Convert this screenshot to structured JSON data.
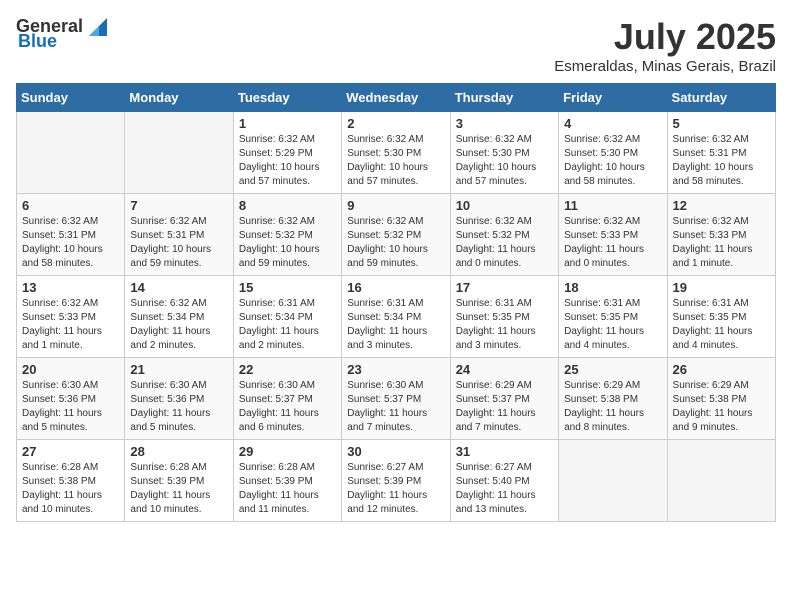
{
  "header": {
    "logo_general": "General",
    "logo_blue": "Blue",
    "month_year": "July 2025",
    "location": "Esmeraldas, Minas Gerais, Brazil"
  },
  "days_of_week": [
    "Sunday",
    "Monday",
    "Tuesday",
    "Wednesday",
    "Thursday",
    "Friday",
    "Saturday"
  ],
  "weeks": [
    [
      {
        "day": "",
        "info": ""
      },
      {
        "day": "",
        "info": ""
      },
      {
        "day": "1",
        "info": "Sunrise: 6:32 AM\nSunset: 5:29 PM\nDaylight: 10 hours and 57 minutes."
      },
      {
        "day": "2",
        "info": "Sunrise: 6:32 AM\nSunset: 5:30 PM\nDaylight: 10 hours and 57 minutes."
      },
      {
        "day": "3",
        "info": "Sunrise: 6:32 AM\nSunset: 5:30 PM\nDaylight: 10 hours and 57 minutes."
      },
      {
        "day": "4",
        "info": "Sunrise: 6:32 AM\nSunset: 5:30 PM\nDaylight: 10 hours and 58 minutes."
      },
      {
        "day": "5",
        "info": "Sunrise: 6:32 AM\nSunset: 5:31 PM\nDaylight: 10 hours and 58 minutes."
      }
    ],
    [
      {
        "day": "6",
        "info": "Sunrise: 6:32 AM\nSunset: 5:31 PM\nDaylight: 10 hours and 58 minutes."
      },
      {
        "day": "7",
        "info": "Sunrise: 6:32 AM\nSunset: 5:31 PM\nDaylight: 10 hours and 59 minutes."
      },
      {
        "day": "8",
        "info": "Sunrise: 6:32 AM\nSunset: 5:32 PM\nDaylight: 10 hours and 59 minutes."
      },
      {
        "day": "9",
        "info": "Sunrise: 6:32 AM\nSunset: 5:32 PM\nDaylight: 10 hours and 59 minutes."
      },
      {
        "day": "10",
        "info": "Sunrise: 6:32 AM\nSunset: 5:32 PM\nDaylight: 11 hours and 0 minutes."
      },
      {
        "day": "11",
        "info": "Sunrise: 6:32 AM\nSunset: 5:33 PM\nDaylight: 11 hours and 0 minutes."
      },
      {
        "day": "12",
        "info": "Sunrise: 6:32 AM\nSunset: 5:33 PM\nDaylight: 11 hours and 1 minute."
      }
    ],
    [
      {
        "day": "13",
        "info": "Sunrise: 6:32 AM\nSunset: 5:33 PM\nDaylight: 11 hours and 1 minute."
      },
      {
        "day": "14",
        "info": "Sunrise: 6:32 AM\nSunset: 5:34 PM\nDaylight: 11 hours and 2 minutes."
      },
      {
        "day": "15",
        "info": "Sunrise: 6:31 AM\nSunset: 5:34 PM\nDaylight: 11 hours and 2 minutes."
      },
      {
        "day": "16",
        "info": "Sunrise: 6:31 AM\nSunset: 5:34 PM\nDaylight: 11 hours and 3 minutes."
      },
      {
        "day": "17",
        "info": "Sunrise: 6:31 AM\nSunset: 5:35 PM\nDaylight: 11 hours and 3 minutes."
      },
      {
        "day": "18",
        "info": "Sunrise: 6:31 AM\nSunset: 5:35 PM\nDaylight: 11 hours and 4 minutes."
      },
      {
        "day": "19",
        "info": "Sunrise: 6:31 AM\nSunset: 5:35 PM\nDaylight: 11 hours and 4 minutes."
      }
    ],
    [
      {
        "day": "20",
        "info": "Sunrise: 6:30 AM\nSunset: 5:36 PM\nDaylight: 11 hours and 5 minutes."
      },
      {
        "day": "21",
        "info": "Sunrise: 6:30 AM\nSunset: 5:36 PM\nDaylight: 11 hours and 5 minutes."
      },
      {
        "day": "22",
        "info": "Sunrise: 6:30 AM\nSunset: 5:37 PM\nDaylight: 11 hours and 6 minutes."
      },
      {
        "day": "23",
        "info": "Sunrise: 6:30 AM\nSunset: 5:37 PM\nDaylight: 11 hours and 7 minutes."
      },
      {
        "day": "24",
        "info": "Sunrise: 6:29 AM\nSunset: 5:37 PM\nDaylight: 11 hours and 7 minutes."
      },
      {
        "day": "25",
        "info": "Sunrise: 6:29 AM\nSunset: 5:38 PM\nDaylight: 11 hours and 8 minutes."
      },
      {
        "day": "26",
        "info": "Sunrise: 6:29 AM\nSunset: 5:38 PM\nDaylight: 11 hours and 9 minutes."
      }
    ],
    [
      {
        "day": "27",
        "info": "Sunrise: 6:28 AM\nSunset: 5:38 PM\nDaylight: 11 hours and 10 minutes."
      },
      {
        "day": "28",
        "info": "Sunrise: 6:28 AM\nSunset: 5:39 PM\nDaylight: 11 hours and 10 minutes."
      },
      {
        "day": "29",
        "info": "Sunrise: 6:28 AM\nSunset: 5:39 PM\nDaylight: 11 hours and 11 minutes."
      },
      {
        "day": "30",
        "info": "Sunrise: 6:27 AM\nSunset: 5:39 PM\nDaylight: 11 hours and 12 minutes."
      },
      {
        "day": "31",
        "info": "Sunrise: 6:27 AM\nSunset: 5:40 PM\nDaylight: 11 hours and 13 minutes."
      },
      {
        "day": "",
        "info": ""
      },
      {
        "day": "",
        "info": ""
      }
    ]
  ]
}
